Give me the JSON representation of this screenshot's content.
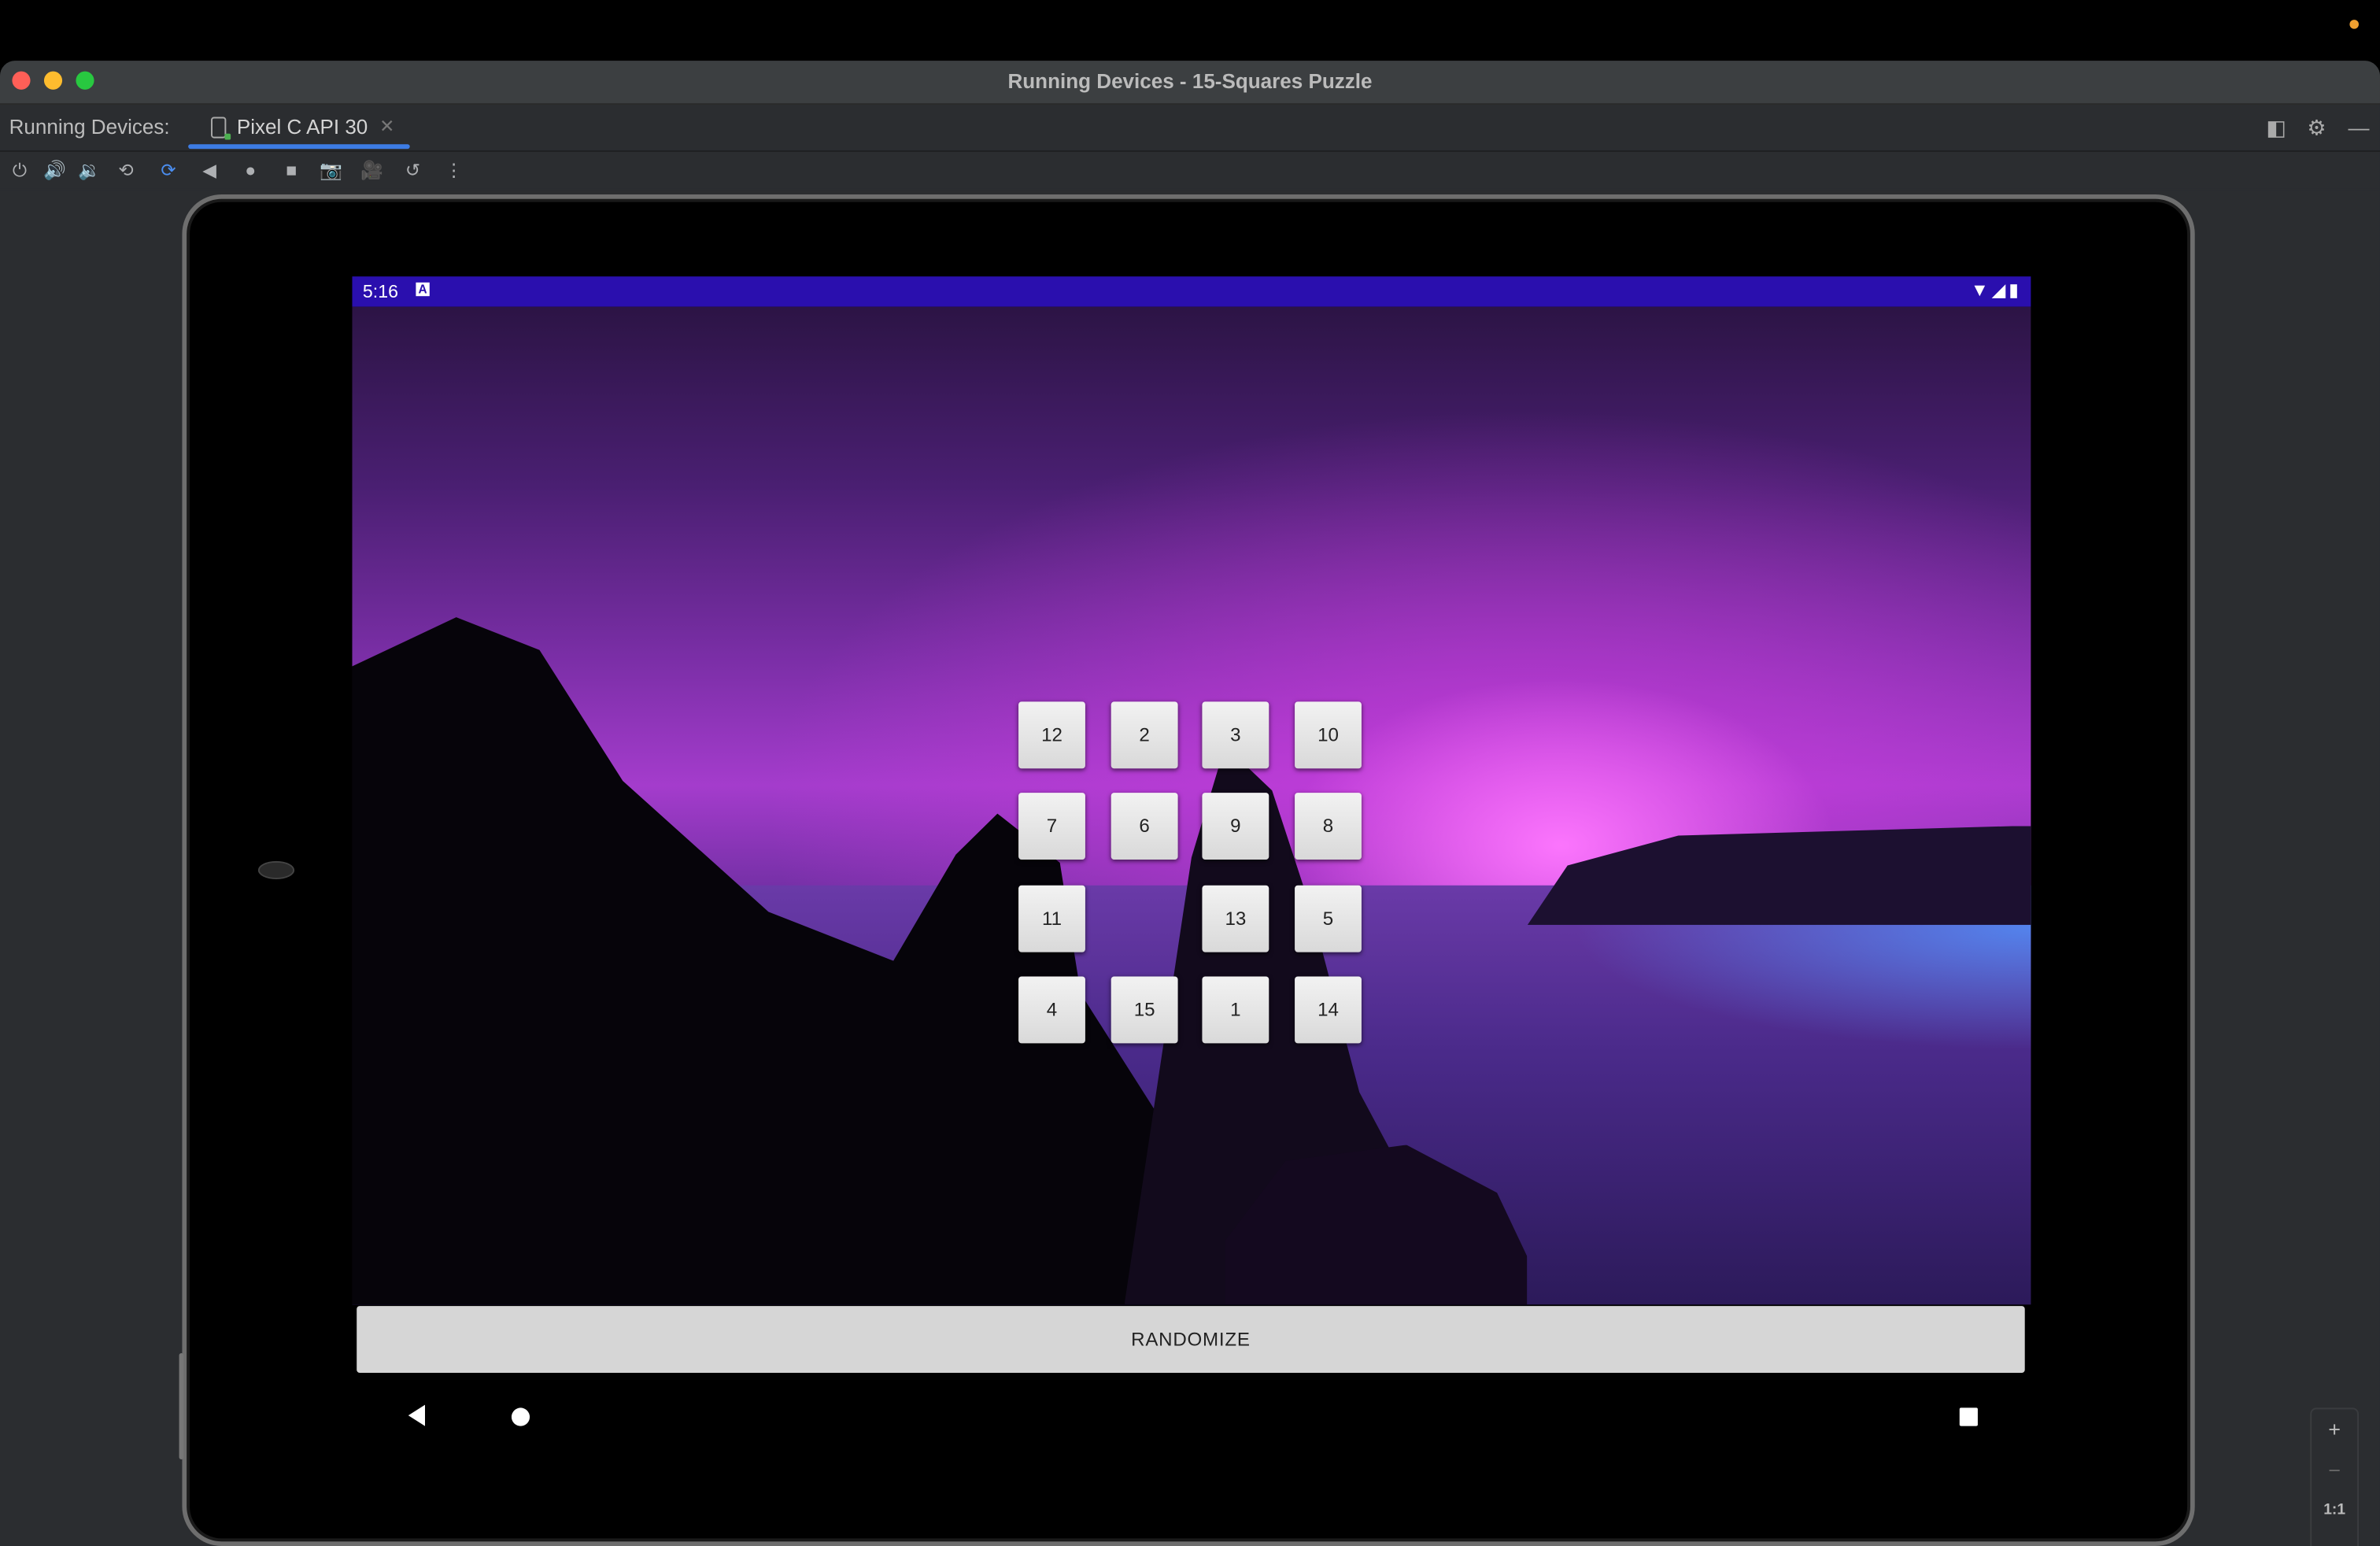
{
  "window": {
    "title": "Running Devices - 15-Squares Puzzle"
  },
  "tool_window": {
    "label": "Running Devices:",
    "tab_label": "Pixel C API 30"
  },
  "device": {
    "status_time": "5:16",
    "status_a_icon": "A",
    "status_right_icons": "wifi-icon signal-icon battery-icon",
    "puzzle_tiles": [
      "12",
      "2",
      "3",
      "10",
      "7",
      "6",
      "9",
      "8",
      "11",
      "",
      "13",
      "5",
      "4",
      "15",
      "1",
      "14"
    ],
    "randomize_label": "RANDOMIZE"
  },
  "zoom": {
    "plus": "+",
    "minus": "−",
    "actual": "1:1"
  },
  "colors": {
    "status_bar": "#2a0fae",
    "accent_tab": "#3d7ce4"
  }
}
